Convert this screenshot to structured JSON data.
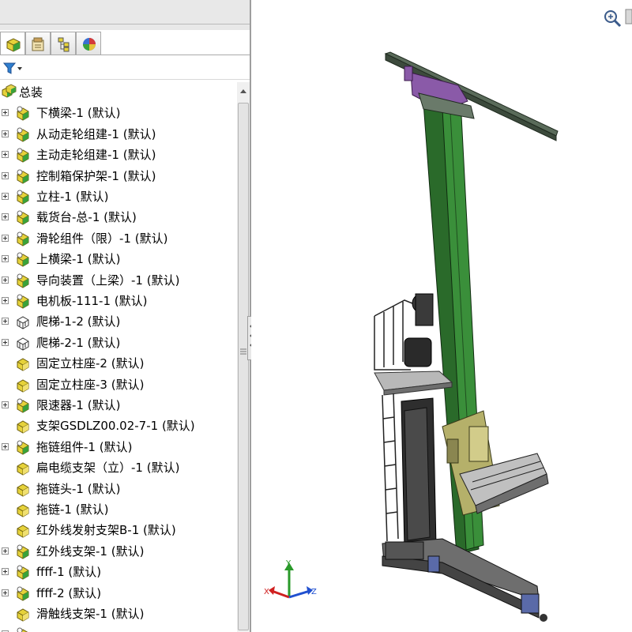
{
  "feature_tree": {
    "root": {
      "label": "总装",
      "icon": "assembly-icon"
    },
    "items": [
      {
        "label": "下横梁-1 (默认)",
        "icon": "part-icon",
        "expandable": true
      },
      {
        "label": "从动走轮组建-1 (默认)",
        "icon": "part-icon",
        "expandable": true
      },
      {
        "label": "主动走轮组建-1 (默认)",
        "icon": "part-icon",
        "expandable": true
      },
      {
        "label": "控制箱保护架-1 (默认)",
        "icon": "part-icon",
        "expandable": true
      },
      {
        "label": "立柱-1 (默认)",
        "icon": "part-icon",
        "expandable": true
      },
      {
        "label": "载货台-总-1 (默认)",
        "icon": "part-icon",
        "expandable": true
      },
      {
        "label": "滑轮组件（限）-1 (默认)",
        "icon": "part-icon",
        "expandable": true
      },
      {
        "label": "上横梁-1 (默认)",
        "icon": "part-icon",
        "expandable": true
      },
      {
        "label": "导向装置（上梁）-1 (默认)",
        "icon": "part-icon",
        "expandable": true
      },
      {
        "label": "电机板-111-1 (默认)",
        "icon": "part-icon",
        "expandable": true
      },
      {
        "label": "爬梯-1-2 (默认)",
        "icon": "wire-part-icon",
        "expandable": true
      },
      {
        "label": "爬梯-2-1 (默认)",
        "icon": "wire-part-icon",
        "expandable": true
      },
      {
        "label": "固定立柱座-2 (默认)",
        "icon": "single-part-icon",
        "expandable": false
      },
      {
        "label": "固定立柱座-3 (默认)",
        "icon": "single-part-icon",
        "expandable": false
      },
      {
        "label": "限速器-1 (默认)",
        "icon": "part-icon",
        "expandable": true
      },
      {
        "label": "支架GSDLZ00.02-7-1 (默认)",
        "icon": "single-part-icon",
        "expandable": false
      },
      {
        "label": "拖链组件-1 (默认)",
        "icon": "part-icon",
        "expandable": true
      },
      {
        "label": "扁电缆支架（立）-1 (默认)",
        "icon": "single-part-icon",
        "expandable": false
      },
      {
        "label": "拖链头-1 (默认)",
        "icon": "single-part-icon",
        "expandable": false
      },
      {
        "label": "拖链-1 (默认)",
        "icon": "single-part-icon",
        "expandable": false
      },
      {
        "label": "红外线发射支架B-1 (默认)",
        "icon": "single-part-icon",
        "expandable": false
      },
      {
        "label": "红外线支架-1 (默认)",
        "icon": "part-icon",
        "expandable": true
      },
      {
        "label": "ffff-1 (默认)",
        "icon": "part-icon",
        "expandable": true
      },
      {
        "label": "ffff-2 (默认)",
        "icon": "part-icon",
        "expandable": true
      },
      {
        "label": "滑触线支架-1 (默认)",
        "icon": "single-part-icon",
        "expandable": false
      },
      {
        "label": "",
        "icon": "part-icon",
        "expandable": true
      }
    ]
  },
  "panel_tabs": [
    {
      "name": "feature-manager-tab",
      "icon": "feature-manager-icon",
      "active": true
    },
    {
      "name": "property-manager-tab",
      "icon": "property-manager-icon",
      "active": false
    },
    {
      "name": "configuration-manager-tab",
      "icon": "configuration-manager-icon",
      "active": false
    },
    {
      "name": "display-manager-tab",
      "icon": "display-manager-icon",
      "active": false
    }
  ],
  "triad": {
    "x": "X",
    "y": "Y",
    "z": "Z"
  },
  "colors": {
    "mast_green": "#2f7f2f",
    "beam_dark": "#5a6b5a",
    "clamp_purple": "#8a5aa8",
    "carriage_olive": "#b5b06a",
    "steel_grey": "#6e6e6e",
    "motor_blue": "#5a6aa8"
  }
}
